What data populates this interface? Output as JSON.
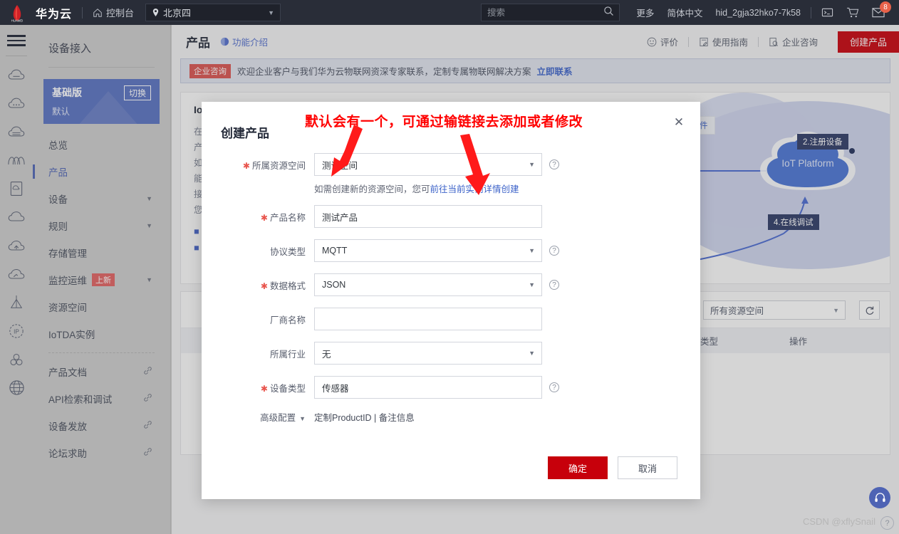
{
  "topbar": {
    "brand": "华为云",
    "console": "控制台",
    "region": "北京四",
    "search_placeholder": "搜索",
    "more": "更多",
    "language": "简体中文",
    "account": "hid_2gja32hko7-7k58",
    "mail_badge": "8",
    "icons": {
      "home": "home-icon",
      "pin": "location-pin-icon",
      "search": "search-icon",
      "terminal": "terminal-icon",
      "cart": "shopping-cart-icon",
      "mail": "mail-icon"
    }
  },
  "sidebar": {
    "title": "设备接入",
    "version_card": {
      "name": "基础版",
      "sub": "默认",
      "switch_label": "切换"
    },
    "items": [
      {
        "label": "总览",
        "active": false,
        "arrow": false,
        "link": false,
        "badge": ""
      },
      {
        "label": "产品",
        "active": true,
        "arrow": false,
        "link": false,
        "badge": ""
      },
      {
        "label": "设备",
        "active": false,
        "arrow": true,
        "link": false,
        "badge": ""
      },
      {
        "label": "规则",
        "active": false,
        "arrow": true,
        "link": false,
        "badge": ""
      },
      {
        "label": "存储管理",
        "active": false,
        "arrow": false,
        "link": false,
        "badge": ""
      },
      {
        "label": "监控运维",
        "active": false,
        "arrow": true,
        "link": false,
        "badge": "上新"
      },
      {
        "label": "资源空间",
        "active": false,
        "arrow": false,
        "link": false,
        "badge": ""
      },
      {
        "label": "IoTDA实例",
        "active": false,
        "arrow": false,
        "link": false,
        "badge": ""
      }
    ],
    "link_items": [
      {
        "label": "产品文档"
      },
      {
        "label": "API检索和调试"
      },
      {
        "label": "设备发放"
      },
      {
        "label": "论坛求助"
      }
    ]
  },
  "page": {
    "title": "产品",
    "feature_link": "功能介绍",
    "actions": [
      {
        "label": "评价",
        "icon": "smiley-icon"
      },
      {
        "label": "使用指南",
        "icon": "guide-book-icon"
      },
      {
        "label": "企业咨询",
        "icon": "consult-icon"
      }
    ],
    "create_button": "创建产品",
    "banner": {
      "tag": "企业咨询",
      "text": "欢迎企业客户与我们华为云物联网资深专家联系，定制专属物联网解决方案",
      "link": "立即联系"
    }
  },
  "guide": {
    "title": "IoT",
    "lines": [
      "在",
      "产",
      "如",
      "能",
      "接",
      "您"
    ],
    "links": [
      "■",
      "■"
    ],
    "diagram": {
      "cloud_label": "IoT Platform",
      "flag_register": "2.注册设备",
      "flag_debug": "4.在线调试",
      "mini_box": "件"
    }
  },
  "list": {
    "space_filter": "所有资源空间",
    "refresh_icon": "refresh-icon",
    "columns": [
      "协议类型",
      "操作"
    ]
  },
  "dialog": {
    "title": "创建产品",
    "close_icon": "close-icon",
    "fields": [
      {
        "label": "所属资源空间",
        "required": true,
        "type": "select",
        "value": "测试空间",
        "help": true
      },
      {
        "label": "产品名称",
        "required": true,
        "type": "input",
        "value": "测试产品",
        "help": false
      },
      {
        "label": "协议类型",
        "required": false,
        "type": "select",
        "value": "MQTT",
        "help": true
      },
      {
        "label": "数据格式",
        "required": true,
        "type": "select",
        "value": "JSON",
        "help": true
      },
      {
        "label": "厂商名称",
        "required": false,
        "type": "input",
        "value": "",
        "help": false
      },
      {
        "label": "所属行业",
        "required": false,
        "type": "select",
        "value": "无",
        "help": false
      },
      {
        "label": "设备类型",
        "required": true,
        "type": "input",
        "value": "传感器",
        "help": true
      }
    ],
    "hint_text": "如需创建新的资源空间，您可",
    "hint_link": "前往当前实例详情创建",
    "advanced_label": "高级配置",
    "advanced_value": "定制ProductID | 备注信息",
    "ok_button": "确定",
    "cancel_button": "取消"
  },
  "annotation": {
    "text": "默认会有一个，可通过输链接去添加或者修改",
    "color": "#ff0000"
  },
  "footer": {
    "watermark": "CSDN @xflySnail",
    "help_fab": "headset-icon",
    "question_fab": "?"
  },
  "colors": {
    "accent_red": "#c7000b",
    "link_blue": "#3d63c9",
    "sidebar_active": "#4e63b4",
    "topbar_bg": "#292d38"
  }
}
